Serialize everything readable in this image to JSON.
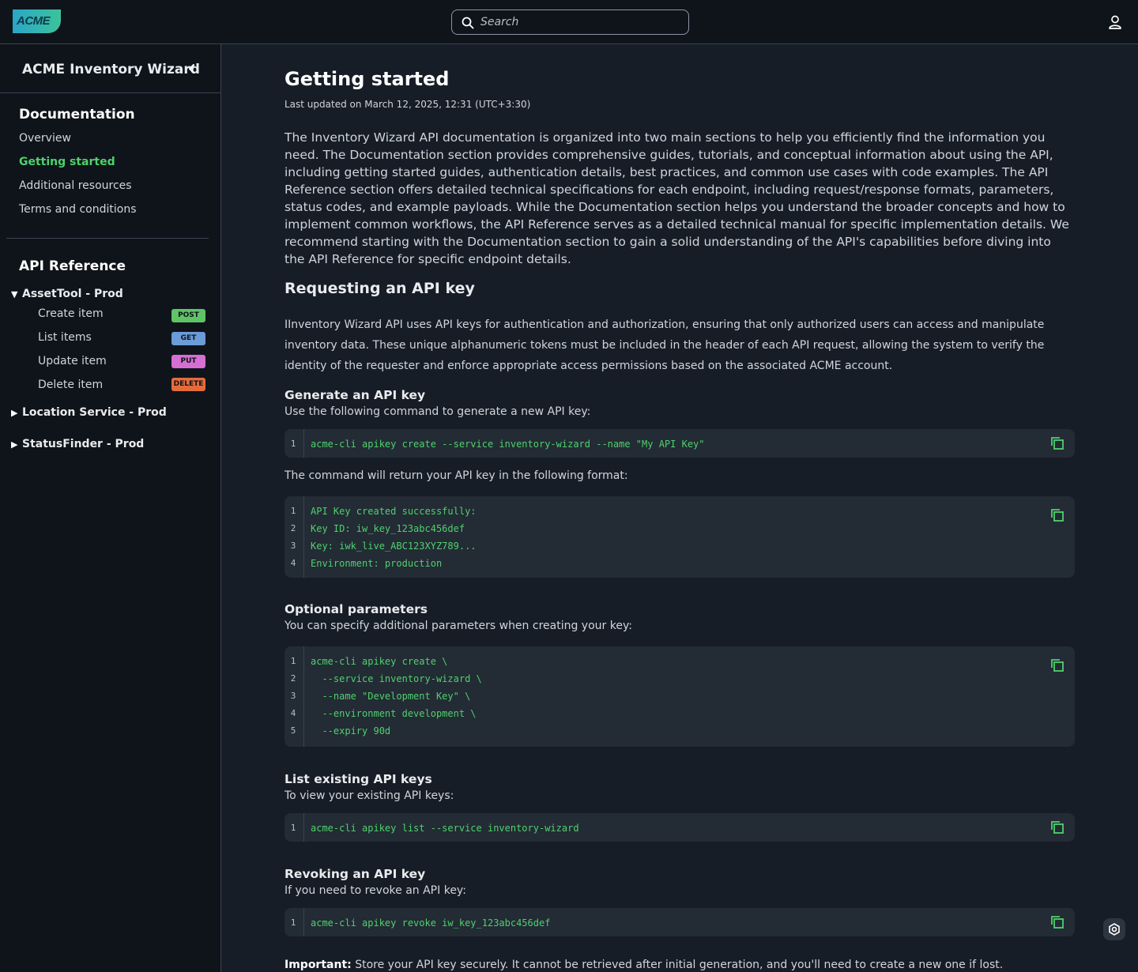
{
  "header": {
    "logo_text": "ACME",
    "search_placeholder": "Search"
  },
  "sidebar": {
    "title": "ACME Inventory Wizard",
    "documentation_heading": "Documentation",
    "doc_links": [
      "Overview",
      "Getting started",
      "Additional resources",
      "Terms and conditions"
    ],
    "active_link": "Getting started",
    "api_reference_heading": "API Reference",
    "groups": [
      {
        "name": "AssetTool - Prod",
        "expanded": true,
        "items": [
          {
            "label": "Create item",
            "method": "POST"
          },
          {
            "label": "List items",
            "method": "GET"
          },
          {
            "label": "Update item",
            "method": "PUT"
          },
          {
            "label": "Delete item",
            "method": "DELETE"
          }
        ]
      },
      {
        "name": "Location Service - Prod",
        "expanded": false
      },
      {
        "name": "StatusFinder - Prod",
        "expanded": false
      }
    ]
  },
  "main": {
    "title": "Getting started",
    "last_updated": "Last updated on March 12, 2025, 12:31 (UTC+3:30)",
    "intro": "The Inventory Wizard API documentation is organized into two main sections to help you efficiently find the information you need. The Documentation section provides comprehensive guides, tutorials, and conceptual information about using the API, including getting started guides, authentication details, best practices, and common use cases with code examples. The API Reference section offers detailed technical specifications for each endpoint, including request/response formats, parameters, status codes, and example payloads. While the Documentation section helps you understand the broader concepts and how to implement common workflows, the API Reference serves as a detailed technical manual for specific implementation details. We recommend starting with the Documentation section to gain a solid understanding of the API's capabilities before diving into the API Reference for specific endpoint details.",
    "section_heading": "Requesting an API key",
    "section_para": "IInventory Wizard API uses API keys for authentication and authorization, ensuring that only authorized users can access and manipulate inventory data. These unique alphanumeric tokens must be included in the header  of each API request, allowing the system to verify the identity of the  requester and enforce appropriate access permissions based on the  associated ACME account.",
    "generate": {
      "heading": "Generate an API key",
      "desc": "Use the following command to generate a new API key:",
      "code": [
        "acme-cli apikey create --service inventory-wizard --name \"My API Key\""
      ],
      "return_desc": "The command will return your API key in the following format:",
      "return_code": [
        "API Key created successfully:",
        "Key ID: iw_key_123abc456def",
        "Key: iwk_live_ABC123XYZ789...",
        "Environment: production"
      ]
    },
    "optional": {
      "heading": "Optional parameters",
      "desc": "You can specify additional parameters when creating your key:",
      "code": [
        "acme-cli apikey create \\",
        "  --service inventory-wizard \\",
        "  --name \"Development Key\" \\",
        "  --environment development \\",
        "  --expiry 90d"
      ]
    },
    "list": {
      "heading": "List existing API keys",
      "desc": "To view your existing API keys:",
      "code": [
        "acme-cli apikey list --service inventory-wizard"
      ]
    },
    "revoke": {
      "heading": "Revoking an API key",
      "desc": "If you need to revoke an API key:",
      "code": [
        "acme-cli apikey revoke iw_key_123abc456def"
      ]
    },
    "important_label": "Important:",
    "important_text": " Store your API key securely. It cannot be retrieved after initial generation, and you'll need to create a new one if lost."
  },
  "colors": {
    "accent": "#4fd16c",
    "background": "#161d26",
    "sidebar": "#0f141a",
    "code_bg": "#232b35"
  },
  "icons": [
    "search-icon",
    "user-icon",
    "chevron-left-icon",
    "triangle-down-icon",
    "triangle-right-icon",
    "copy-icon",
    "help-icon"
  ]
}
